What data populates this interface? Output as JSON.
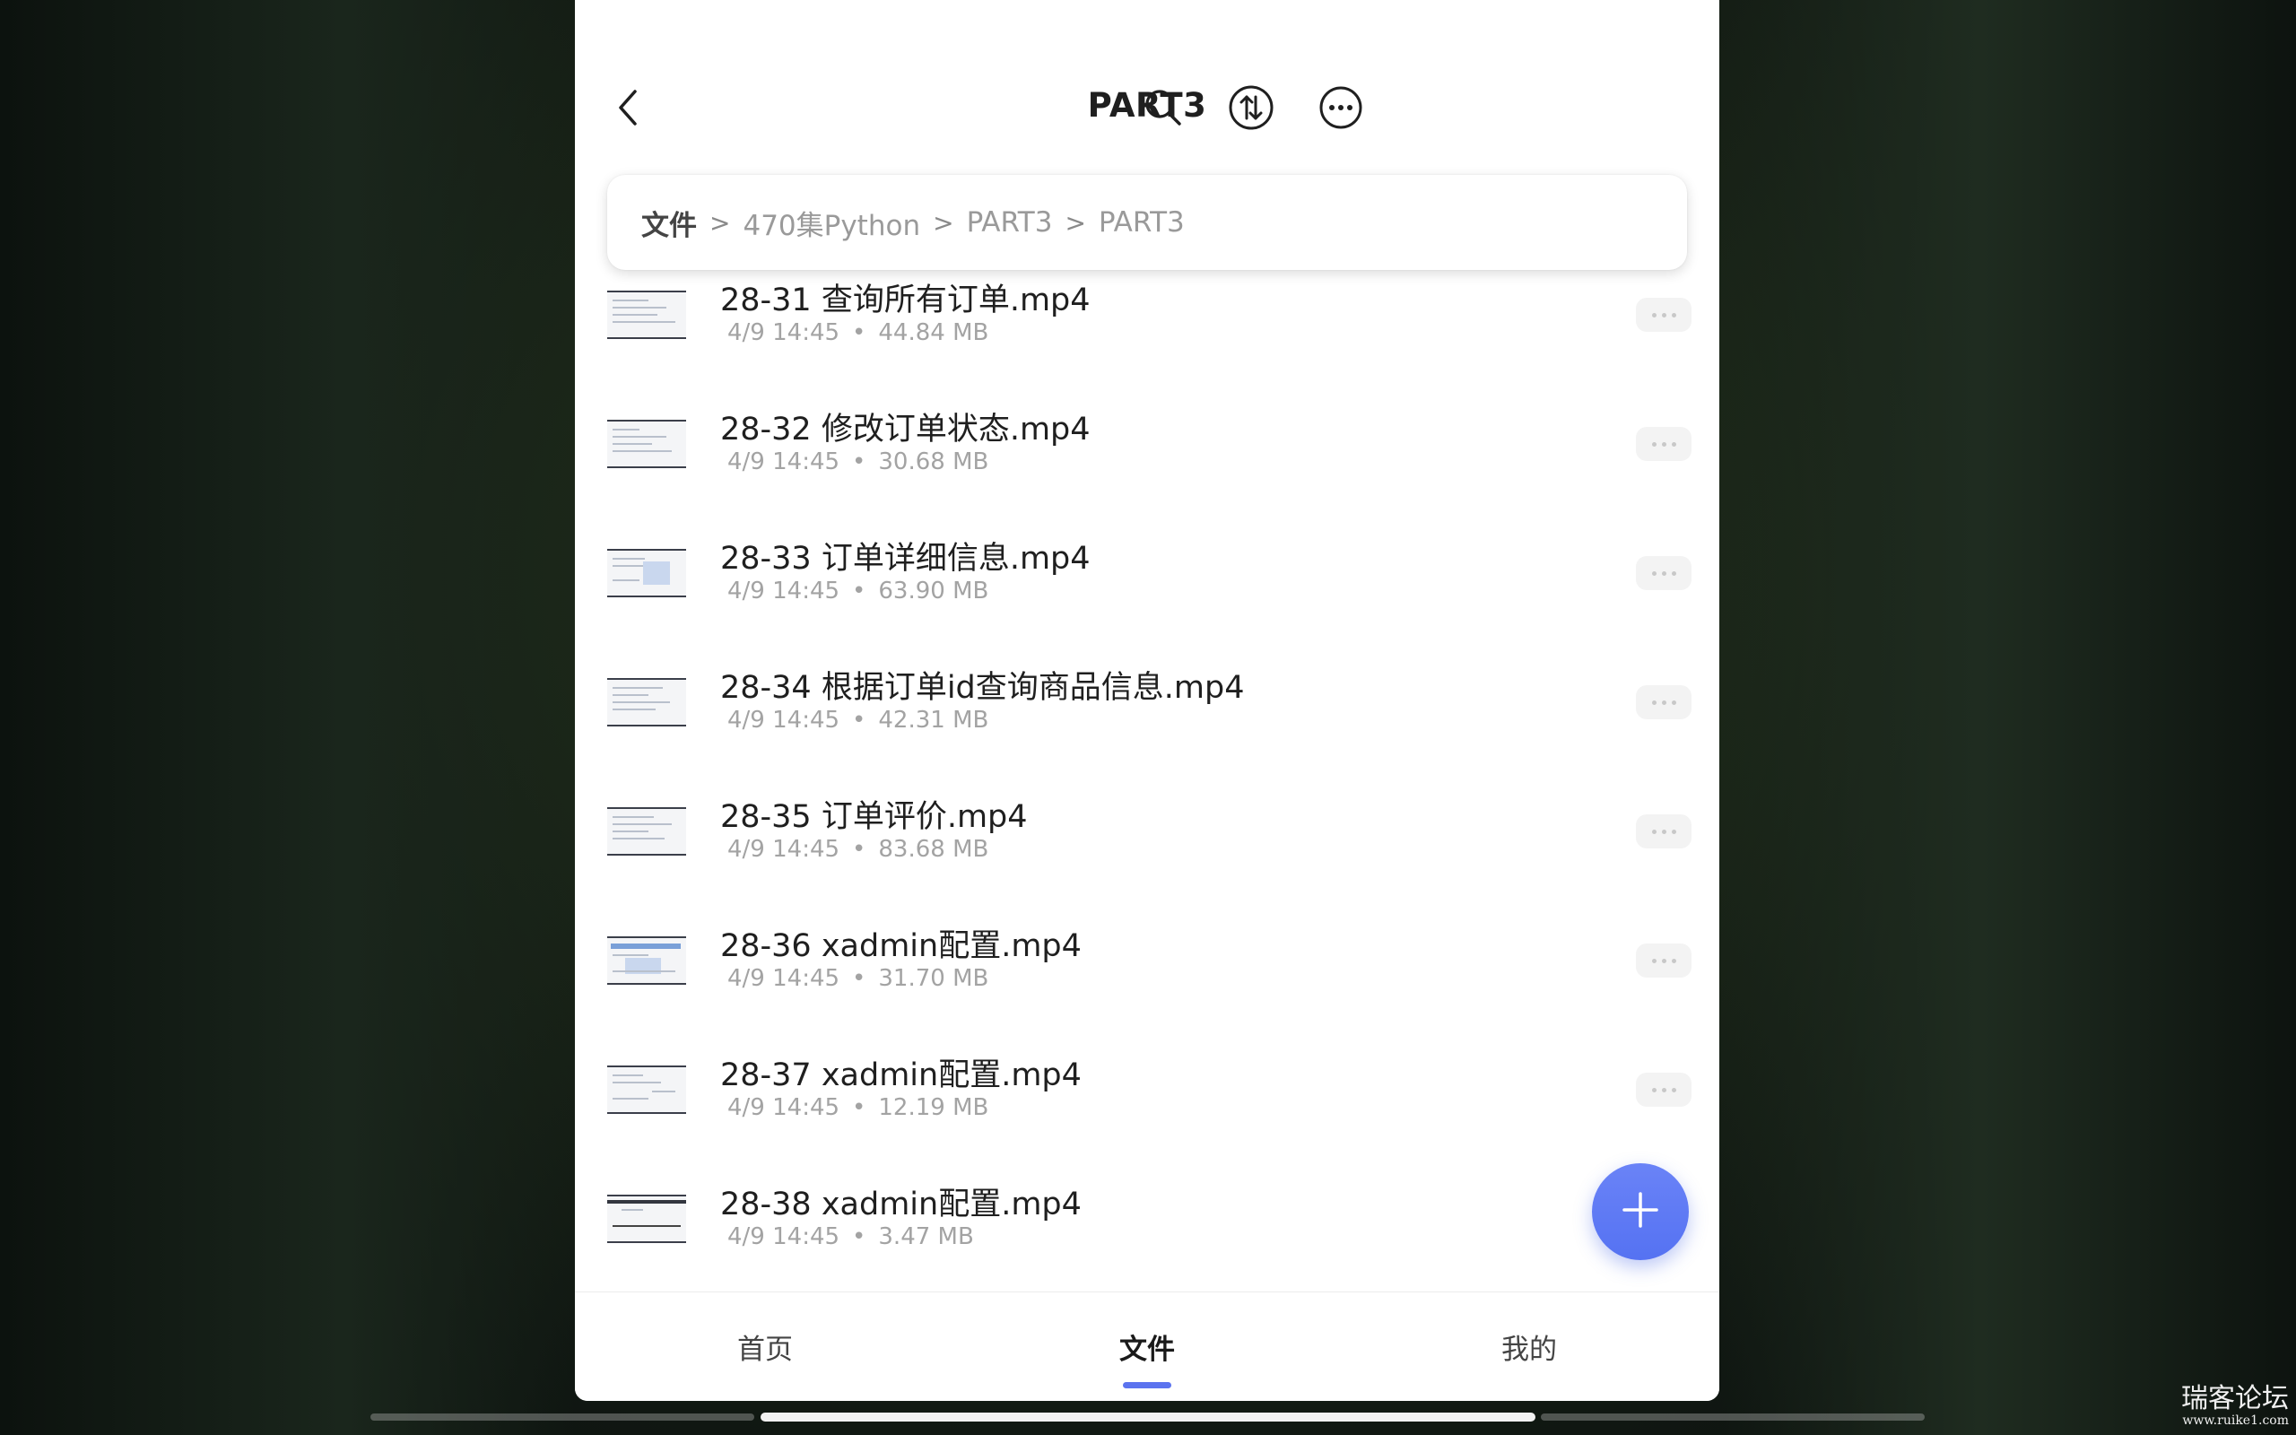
{
  "header": {
    "title": "PART3"
  },
  "breadcrumb": {
    "root": "文件",
    "path": [
      "470集Python",
      "PART3",
      "PART3"
    ]
  },
  "files": [
    {
      "name": "28-31 查询所有订单.mp4",
      "date": "4/9 14:45",
      "size": "44.84 MB"
    },
    {
      "name": "28-32 修改订单状态.mp4",
      "date": "4/9 14:45",
      "size": "30.68 MB"
    },
    {
      "name": "28-33 订单详细信息.mp4",
      "date": "4/9 14:45",
      "size": "63.90 MB"
    },
    {
      "name": "28-34 根据订单id查询商品信息.mp4",
      "date": "4/9 14:45",
      "size": "42.31 MB"
    },
    {
      "name": "28-35 订单评价.mp4",
      "date": "4/9 14:45",
      "size": "83.68 MB"
    },
    {
      "name": "28-36 xadmin配置.mp4",
      "date": "4/9 14:45",
      "size": "31.70 MB"
    },
    {
      "name": "28-37 xadmin配置.mp4",
      "date": "4/9 14:45",
      "size": "12.19 MB"
    },
    {
      "name": "28-38 xadmin配置.mp4",
      "date": "4/9 14:45",
      "size": "3.47 MB"
    }
  ],
  "nav": {
    "home": "首页",
    "files": "文件",
    "mine": "我的",
    "active": "files"
  },
  "watermark": {
    "main": "瑞客论坛",
    "sub": "www.ruike1.com"
  },
  "colors": {
    "accent": "#5b73ef",
    "fab": "#5f7af4",
    "meta_text": "#a3a3a3"
  },
  "icons": {
    "back": "chevron-left-icon",
    "search": "search-icon",
    "sort": "sort-arrows-icon",
    "more": "more-horizontal-icon",
    "add": "plus-icon"
  }
}
